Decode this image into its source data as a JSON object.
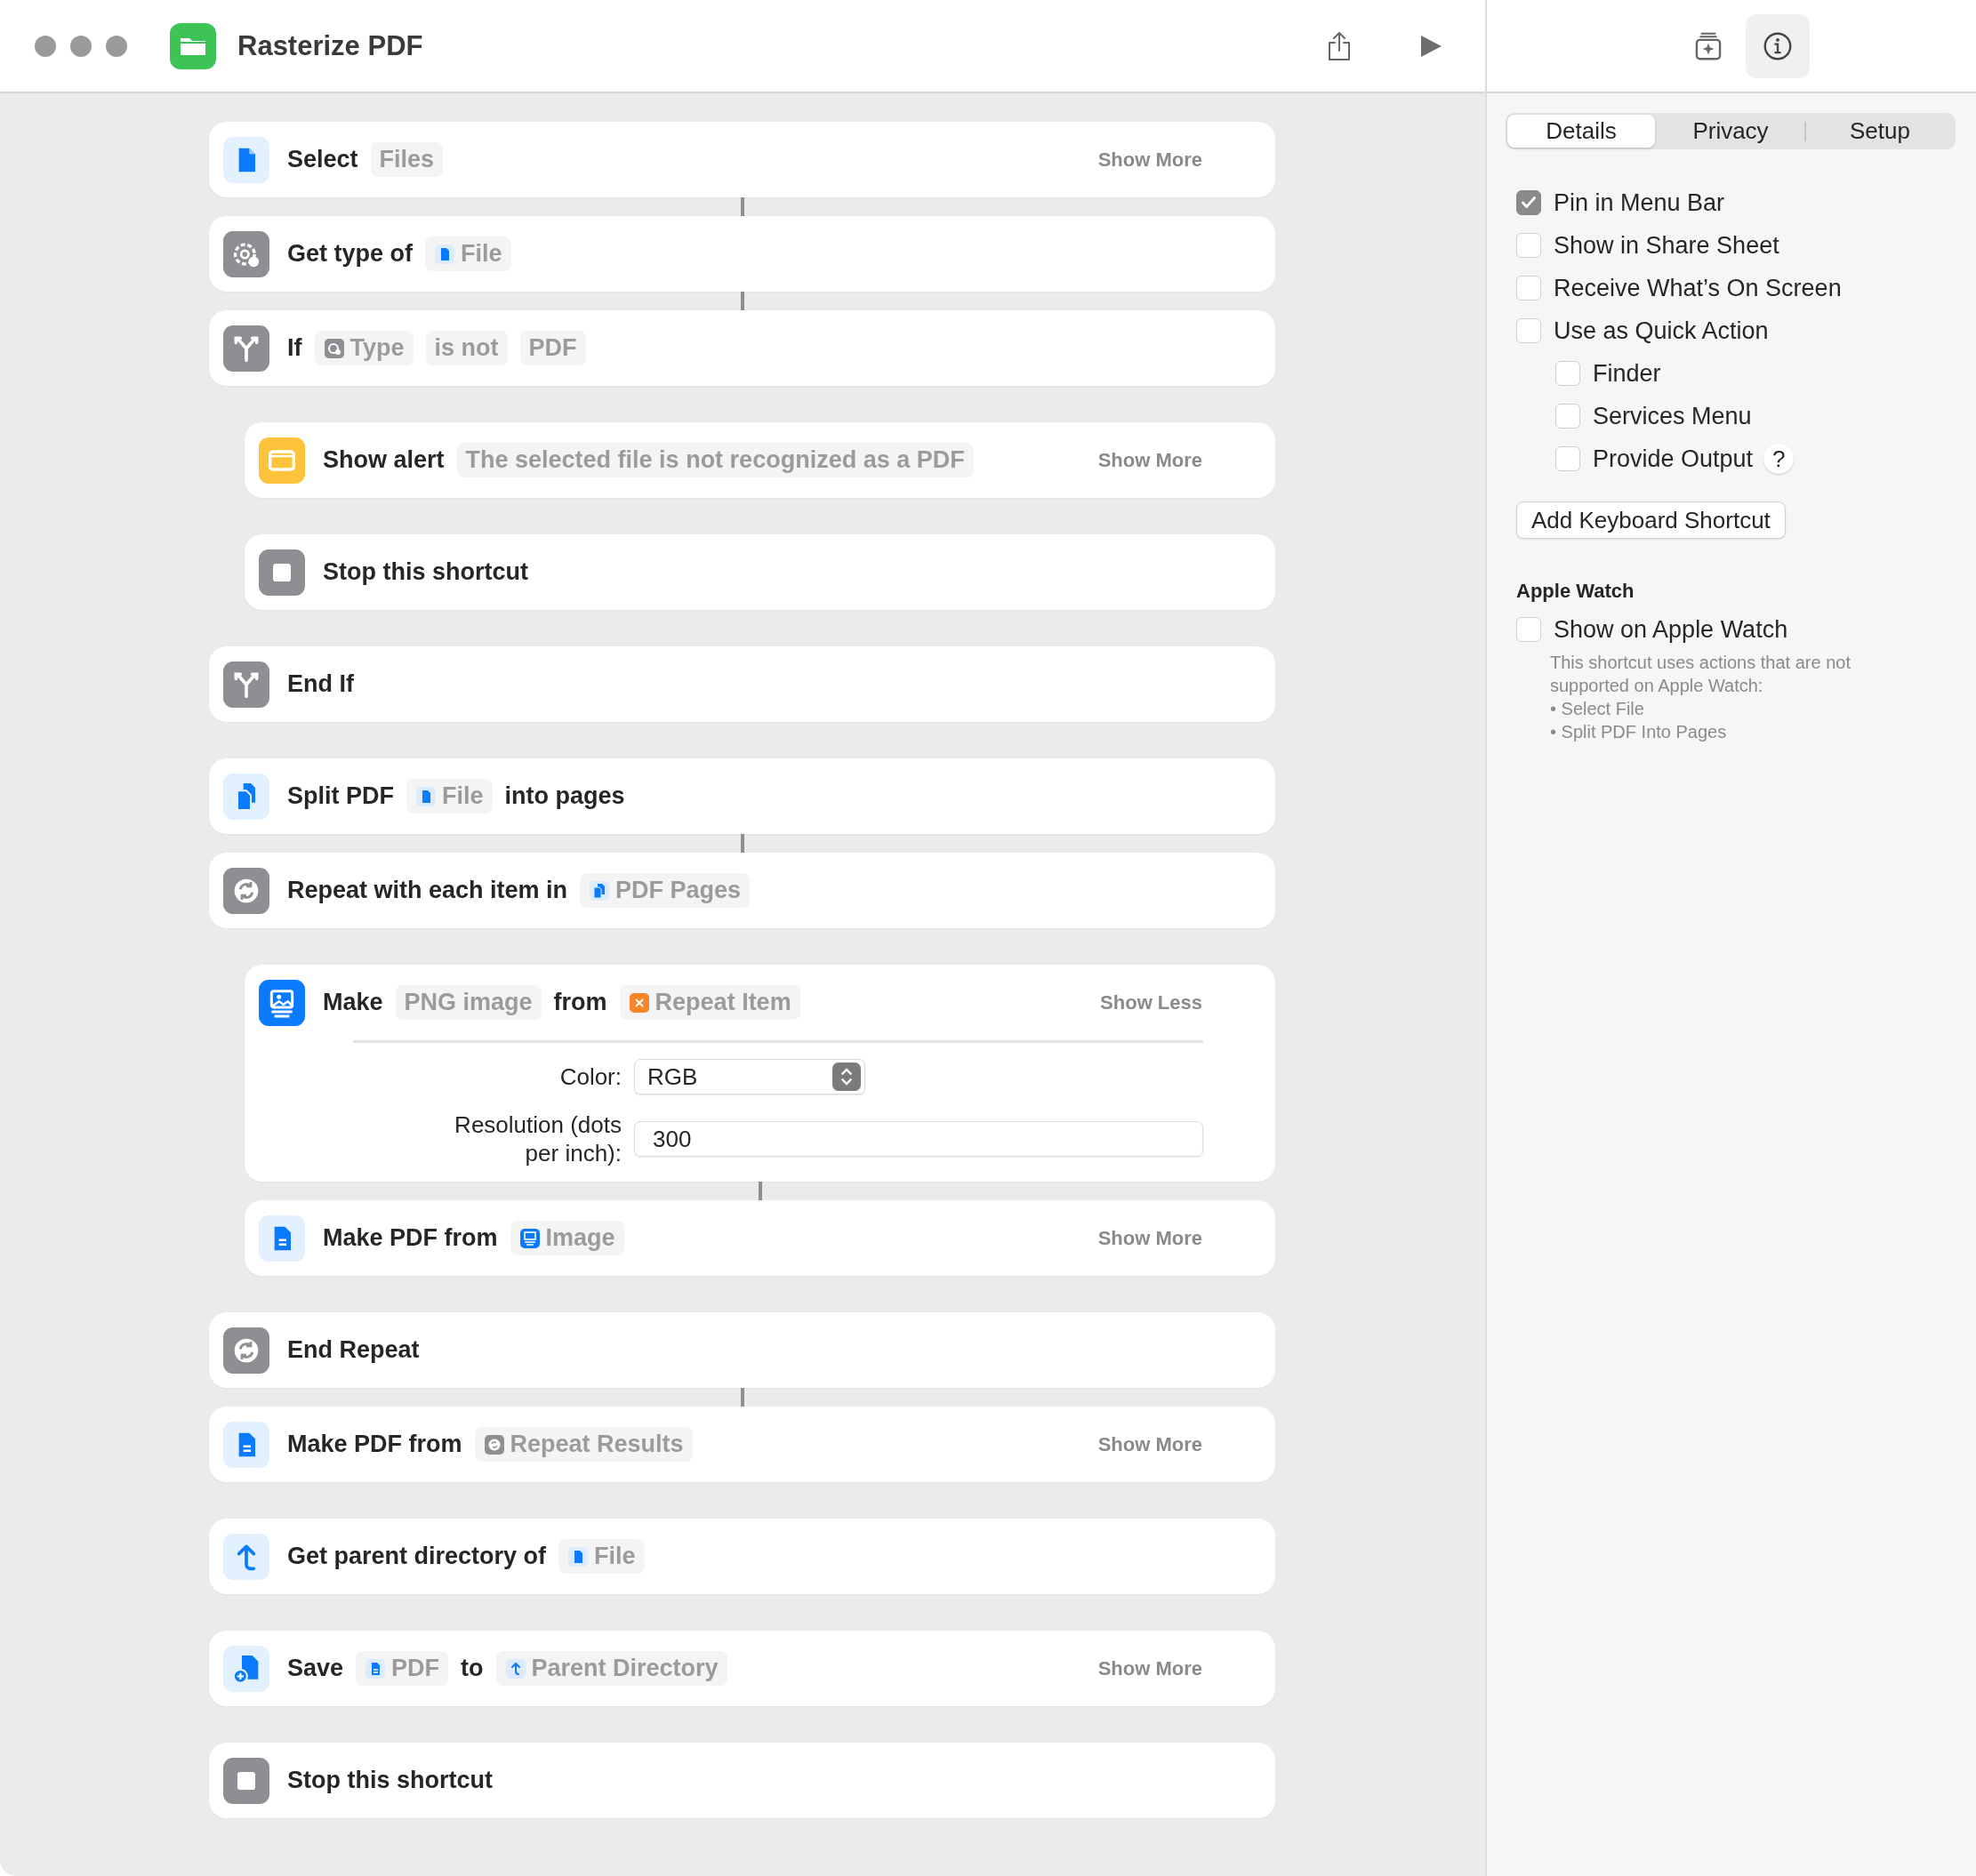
{
  "window": {
    "title": "Rasterize PDF"
  },
  "actions": [
    {
      "kind": "select-file",
      "joined": false,
      "parts": [
        {
          "kind": "label",
          "text": "Select"
        },
        {
          "kind": "token",
          "text": "Files"
        }
      ],
      "toggle": "Show More"
    },
    {
      "kind": "get-type",
      "joined": true,
      "parts": [
        {
          "kind": "label",
          "text": "Get type of"
        },
        {
          "kind": "file-token",
          "text": "File"
        }
      ]
    },
    {
      "kind": "if",
      "joined": true,
      "parts": [
        {
          "kind": "label",
          "text": "If"
        },
        {
          "kind": "type-token",
          "text": "Type"
        },
        {
          "kind": "token",
          "text": "is not"
        },
        {
          "kind": "token",
          "text": "PDF"
        }
      ],
      "children": [
        {
          "kind": "show-alert",
          "joined": false,
          "parts": [
            {
              "kind": "label",
              "text": "Show alert"
            },
            {
              "kind": "token",
              "text": "The selected file is not recognized as a PDF"
            }
          ],
          "toggle": "Show More"
        },
        {
          "kind": "stop",
          "joined": false,
          "parts": [
            {
              "kind": "label",
              "text": "Stop this shortcut"
            }
          ]
        }
      ]
    },
    {
      "kind": "end-if",
      "joined": false,
      "parts": [
        {
          "kind": "label",
          "text": "End If"
        }
      ]
    },
    {
      "kind": "split-pdf",
      "joined": false,
      "parts": [
        {
          "kind": "label",
          "text": "Split PDF"
        },
        {
          "kind": "file-token",
          "text": "File"
        },
        {
          "kind": "label",
          "text": "into pages"
        }
      ]
    },
    {
      "kind": "repeat",
      "joined": true,
      "parts": [
        {
          "kind": "label",
          "text": "Repeat with each item in"
        },
        {
          "kind": "pages-token",
          "text": "PDF Pages"
        }
      ],
      "children": [
        {
          "kind": "make-image",
          "joined": false,
          "parts": [
            {
              "kind": "label",
              "text": "Make"
            },
            {
              "kind": "token",
              "text": "PNG image"
            },
            {
              "kind": "label",
              "text": "from"
            },
            {
              "kind": "variable-token",
              "text": "Repeat Item"
            }
          ],
          "toggle": "Show Less",
          "params": [
            {
              "kind": "popup",
              "label": "Color:",
              "value": "RGB"
            },
            {
              "kind": "field",
              "label": "Resolution (dots per inch):",
              "value": "300"
            }
          ]
        },
        {
          "kind": "make-pdf",
          "joined": true,
          "parts": [
            {
              "kind": "label",
              "text": "Make PDF from"
            },
            {
              "kind": "image-token",
              "text": "Image"
            }
          ],
          "toggle": "Show More"
        }
      ]
    },
    {
      "kind": "end-repeat",
      "joined": false,
      "parts": [
        {
          "kind": "label",
          "text": "End Repeat"
        }
      ]
    },
    {
      "kind": "make-pdf",
      "joined": true,
      "parts": [
        {
          "kind": "label",
          "text": "Make PDF from"
        },
        {
          "kind": "repeat-token",
          "text": "Repeat Results"
        }
      ],
      "toggle": "Show More"
    },
    {
      "kind": "get-parent",
      "joined": false,
      "parts": [
        {
          "kind": "label",
          "text": "Get parent directory of"
        },
        {
          "kind": "file-token",
          "text": "File"
        }
      ]
    },
    {
      "kind": "save",
      "joined": false,
      "parts": [
        {
          "kind": "label",
          "text": "Save"
        },
        {
          "kind": "document-token",
          "text": "PDF"
        },
        {
          "kind": "label",
          "text": "to"
        },
        {
          "kind": "directory-token",
          "text": "Parent Directory"
        }
      ],
      "toggle": "Show More"
    },
    {
      "kind": "stop",
      "joined": false,
      "parts": [
        {
          "kind": "label",
          "text": "Stop this shortcut"
        }
      ]
    }
  ],
  "inspector_toolbar": [
    {
      "kind": "gallery",
      "selected": false
    },
    {
      "kind": "info",
      "selected": true
    }
  ],
  "tabs": [
    {
      "label": "Details",
      "selected": true
    },
    {
      "label": "Privacy",
      "selected": false
    },
    {
      "label": "Setup",
      "selected": false
    }
  ],
  "options": [
    {
      "label": "Pin in Menu Bar",
      "checked": true
    },
    {
      "label": "Show in Share Sheet",
      "checked": false
    },
    {
      "label": "Receive What’s On Screen",
      "checked": false
    },
    {
      "label": "Use as Quick Action",
      "checked": false,
      "children": [
        {
          "label": "Finder",
          "checked": false
        },
        {
          "label": "Services Menu",
          "checked": false
        },
        {
          "label": "Provide Output",
          "checked": false,
          "help": "?"
        }
      ]
    }
  ],
  "shortcut_button": "Add Keyboard Shortcut",
  "apple_watch": {
    "heading": "Apple Watch",
    "option": {
      "label": "Show on Apple Watch",
      "checked": false
    },
    "note": "This shortcut uses actions that are not supported on Apple Watch:",
    "note_items": [
      "• Select File",
      "• Split PDF Into Pages"
    ]
  }
}
